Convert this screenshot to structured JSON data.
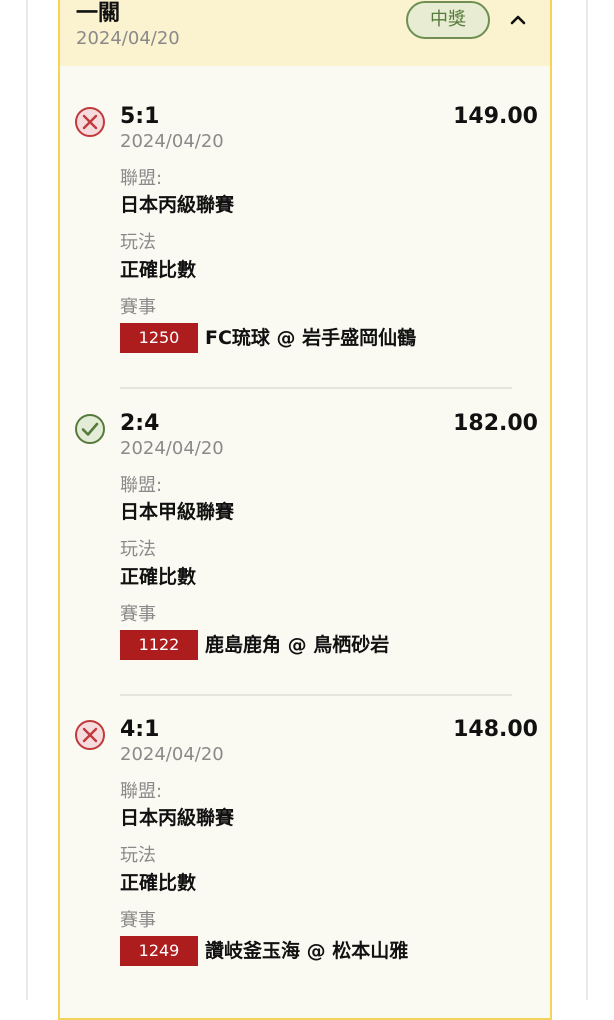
{
  "header": {
    "title": "一關",
    "date": "2024/04/20",
    "status": "中獎"
  },
  "labels": {
    "league": "聯盟:",
    "play": "玩法",
    "match": "賽事"
  },
  "bets": [
    {
      "result_icon": "cross-circle-icon",
      "score": "5:1",
      "odds": "149.00",
      "date": "2024/04/20",
      "league": "日本丙級聯賽",
      "play": "正確比數",
      "match_code": "1250",
      "match_teams": "FC琉球 @ 岩手盛岡仙鶴"
    },
    {
      "result_icon": "check-circle-icon",
      "score": "2:4",
      "odds": "182.00",
      "date": "2024/04/20",
      "league": "日本甲級聯賽",
      "play": "正確比數",
      "match_code": "1122",
      "match_teams": "鹿島鹿角 @ 鳥栖砂岩"
    },
    {
      "result_icon": "cross-circle-icon",
      "score": "4:1",
      "odds": "148.00",
      "date": "2024/04/20",
      "league": "日本丙級聯賽",
      "play": "正確比數",
      "match_code": "1249",
      "match_teams": "讚岐釜玉海 @ 松本山雅"
    }
  ],
  "colors": {
    "card_border": "#f2d45a",
    "header_bg": "#fbf2cf",
    "card_bg": "#fbfaf2",
    "win_green": "#567a3b",
    "loss_red": "#c0393b",
    "code_red": "#ad1d1d"
  }
}
